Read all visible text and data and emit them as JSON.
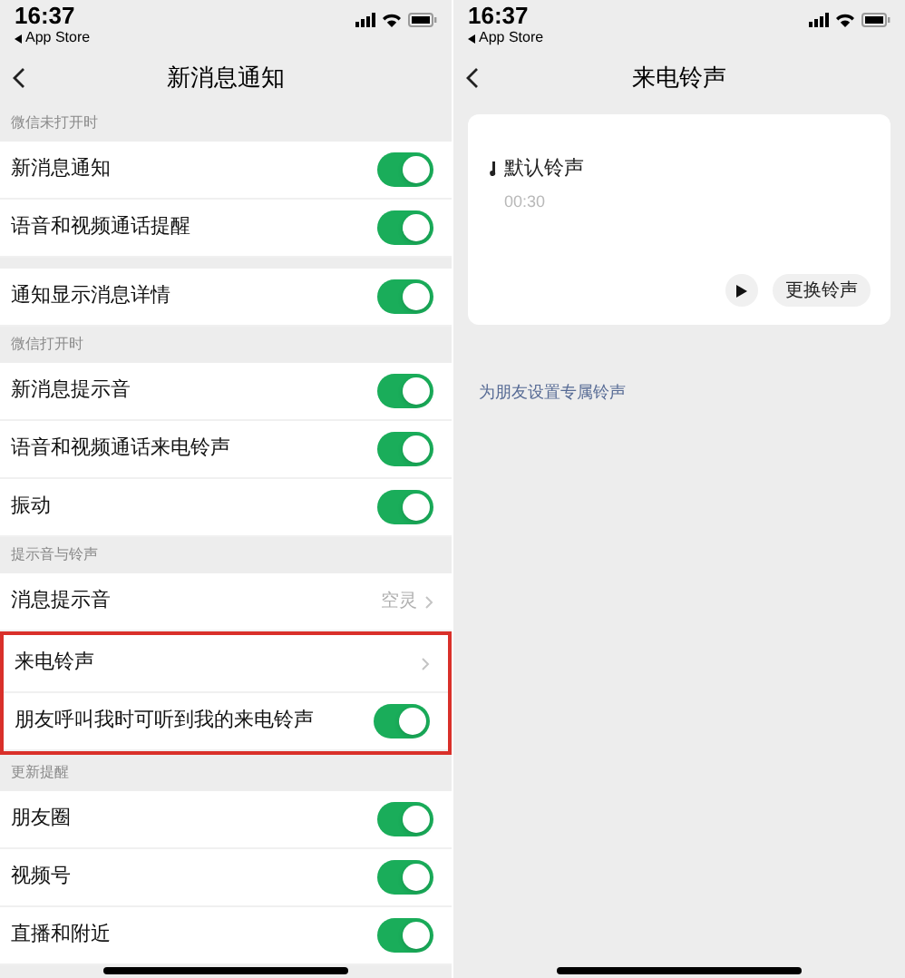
{
  "screens": [
    {
      "status_bar": {
        "time": "16:37",
        "back_app": "App Store"
      },
      "title": "新消息通知",
      "sections": [
        {
          "header": "微信未打开时",
          "groups": [
            [
              {
                "label": "新消息通知",
                "kind": "toggle",
                "on": true
              },
              {
                "label": "语音和视频通话提醒",
                "kind": "toggle",
                "on": true
              }
            ],
            [
              {
                "label": "通知显示消息详情",
                "kind": "toggle",
                "on": true
              }
            ]
          ]
        },
        {
          "header": "微信打开时",
          "groups": [
            [
              {
                "label": "新消息提示音",
                "kind": "toggle",
                "on": true
              },
              {
                "label": "语音和视频通话来电铃声",
                "kind": "toggle",
                "on": true
              },
              {
                "label": "振动",
                "kind": "toggle",
                "on": true
              }
            ]
          ]
        },
        {
          "header": "提示音与铃声",
          "groups": [
            [
              {
                "label": "消息提示音",
                "kind": "link",
                "value": "空灵",
                "highlighted": false
              },
              {
                "label": "来电铃声",
                "kind": "link",
                "highlighted": true
              },
              {
                "label": "朋友呼叫我时可听到我的来电铃声",
                "kind": "toggle",
                "on": true,
                "highlighted": true
              }
            ]
          ]
        },
        {
          "header": "更新提醒",
          "groups": [
            [
              {
                "label": "朋友圈",
                "kind": "toggle",
                "on": true
              },
              {
                "label": "视频号",
                "kind": "toggle",
                "on": true
              },
              {
                "label": "直播和附近",
                "kind": "toggle",
                "on": true
              }
            ]
          ]
        }
      ]
    },
    {
      "status_bar": {
        "time": "16:37",
        "back_app": "App Store"
      },
      "title": "来电铃声",
      "ringtone": {
        "name": "默认铃声",
        "duration": "00:30",
        "change_button": "更换铃声"
      },
      "link": "为朋友设置专属铃声"
    }
  ]
}
